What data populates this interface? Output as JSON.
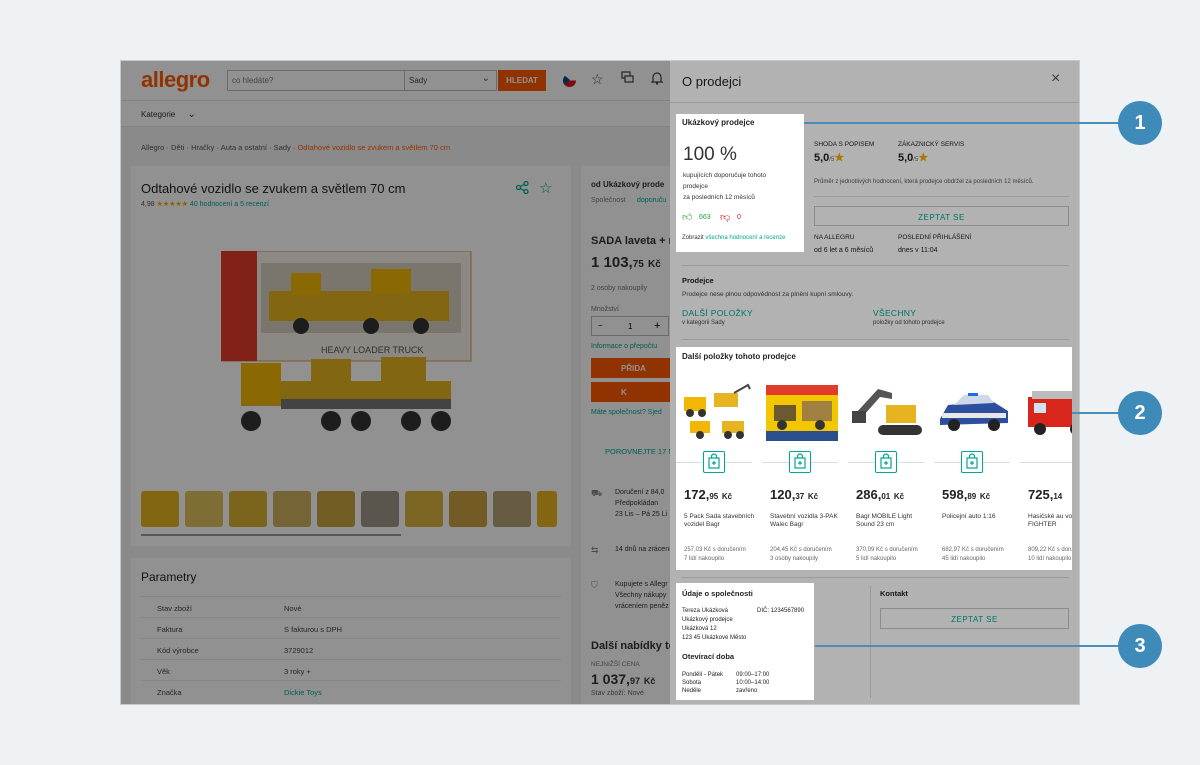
{
  "app": {
    "logo": "allegro",
    "search_placeholder": "co hledáte?",
    "search_category": "Sady",
    "search_button": "HLEDAT",
    "categories_label": "Kategorie"
  },
  "breadcrumb": {
    "items": [
      "Allegro",
      "Děti",
      "Hračky",
      "Auta a ostatní",
      "Sady"
    ],
    "current": "Odtahové vozidlo se zvukem a světlem 70 cm",
    "separator": "·"
  },
  "product": {
    "title": "Odtahové vozidlo se zvukem a světlem 70 cm",
    "rating": "4,98",
    "stars": "★★★★★",
    "reviews_link": "40 hodnocení a 5 recenzí",
    "box_text": "HEAVY LOADER TRUCK"
  },
  "params": {
    "title": "Parametry",
    "rows": [
      {
        "k": "Stav zboží",
        "v": "Nové"
      },
      {
        "k": "Faktura",
        "v": "S fakturou s DPH"
      },
      {
        "k": "Kód výrobce",
        "v": "3729012"
      },
      {
        "k": "Věk",
        "v": "3 roky +"
      },
      {
        "k": "Značka",
        "v": "Dickie Toys"
      }
    ]
  },
  "offer_column": {
    "seller_from": "od Ukázkový prode",
    "company": "Společnost",
    "company_link": "doporuču",
    "offer_title": "SADA laveta + r",
    "price_int": "1 103,",
    "price_dec": "75",
    "price_cur": "Kč",
    "buyers": "2 osoby nakoupily",
    "quantity_label": "Množství",
    "quantity_value": "1",
    "qty_minus": "−",
    "qty_plus": "+",
    "info_link": "Informace o přepočtu",
    "buy_button": "PŘIDA",
    "buy_now_button": "K",
    "company_question": "Máte společnost? Sjed",
    "compare": "POROVNEJTE 17 N",
    "delivery_1": "Doručení z 84,0",
    "delivery_2": "Předpokládan",
    "delivery_3": "23 Lis – Pá 25 Li",
    "return": "14 dnů na zrácení",
    "protect_1": "Kupujete s Allegr",
    "protect_2": "Všechny nákupy",
    "protect_3": "vráceníem peněz",
    "other_offers": "Další nabídky to",
    "lowest_price_label": "NEJNIŽŠÍ CENA",
    "lowest_price_int": "1 037,",
    "lowest_price_dec": "97",
    "lowest_price_cur": "Kč",
    "lowest_cond": "Stav zboží: Nové"
  },
  "panel": {
    "title": "O prodejci",
    "close_icon": "close-icon",
    "seller_name": "Ukázkový prodejce",
    "recommend_pct": "100 %",
    "recommend_text_1": "kupujících doporučuje tohoto",
    "recommend_text_2": "prodejce",
    "recommend_text_3": "za posledních 12 měsíců",
    "positive_count": "663",
    "negative_count": "0",
    "show_all_prefix": "Zobrazit",
    "show_all_link": "všechna hodnocení a recenze",
    "match_label": "SHODA S POPISEM",
    "match_value": "5,0",
    "match_scale": "/5",
    "service_label": "ZÁKAZNICKÝ SERVIS",
    "service_value": "5,0",
    "service_scale": "/5",
    "average_note": "Průměr z jednotlivých hodnocení, která prodejce obdržel za posledních 12 měsíců.",
    "ask_button": "ZEPTAT SE",
    "on_allegro_label": "NA ALLEGRU",
    "on_allegro_value": "od 6 let a 6 měsíců",
    "last_login_label": "POSLEDNÍ PŘIHLÁŠENÍ",
    "last_login_value": "dnes v 11:04",
    "seller_section_title": "Prodejce",
    "seller_section_text": "Prodejce nese plnou odpovědnost za plnění kupní smlouvy.",
    "more_items_link": "DALŠÍ POLOŽKY",
    "more_items_sub": "v kategorii Sady",
    "all_link": "VŠECHNY",
    "all_sub": "položky od tohoto prodejce",
    "items_title": "Další položky tohoto prodejce",
    "items": [
      {
        "price_int": "172,",
        "price_dec": "95",
        "cur": "Kč",
        "name": "5 Pack Sada stavebních vozidel Bagr",
        "delivery": "257,03 Kč s doručením",
        "buyers": "7 lidí nakoupilo"
      },
      {
        "price_int": "120,",
        "price_dec": "37",
        "cur": "Kč",
        "name": "Stavební vozidla 3-PAK Walec Bagr",
        "delivery": "204,45 Kč s doručením",
        "buyers": "3 osoby nakoupily"
      },
      {
        "price_int": "286,",
        "price_dec": "01",
        "cur": "Kč",
        "name": "Bagr MOBILE Light Sound 23 cm",
        "delivery": "370,09 Kč s doručením",
        "buyers": "5 lidí nakoupilo"
      },
      {
        "price_int": "598,",
        "price_dec": "89",
        "cur": "Kč",
        "name": "Policejní auto 1:16",
        "delivery": "682,97 Kč s doručením",
        "buyers": "45 lidí nakoupilo"
      },
      {
        "price_int": "725,",
        "price_dec": "14",
        "cur": "",
        "name": "Hasičské au vodním děl FIGHTER",
        "delivery": "809,22 Kč s doručení",
        "buyers": "10 lidí nakoupilo"
      }
    ],
    "company_title": "Údaje o společnosti",
    "company_lines": [
      "Tereza Ukázková",
      "Ukázkový prodejce",
      "Ukázková 12",
      "123 45 Ukázkové Město"
    ],
    "vat": "DIČ: 1234567890",
    "hours_title": "Otevírací doba",
    "hours": [
      {
        "day": "Pondělí - Pátek",
        "time": "09:00–17:00"
      },
      {
        "day": "Sobota",
        "time": "10:00–14:00"
      },
      {
        "day": "Neděle",
        "time": "zavřeno"
      }
    ],
    "contact_title": "Kontakt",
    "contact_button": "ZEPTAT SE"
  },
  "callouts": [
    "1",
    "2",
    "3"
  ],
  "colors": {
    "brand": "#ff5a00",
    "accent": "#00a790",
    "callout": "#3e8ab8",
    "star": "#f2a900"
  }
}
